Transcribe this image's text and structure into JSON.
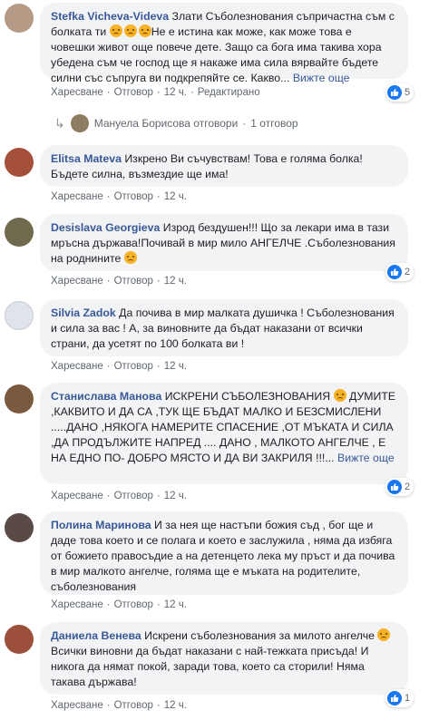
{
  "labels": {
    "like": "Харесване",
    "reply": "Отговор",
    "time": "12 ч.",
    "edited": "Редактирано",
    "see_more": "Вижте още"
  },
  "comments": [
    {
      "author": "Stefka Vicheva-Videva",
      "text": " Злати Съболезнования съпричастна съм с болката ти ",
      "text2": "Не е истина как може, как може това е човешки живот още повече дете. Защо са бога има такива хора убедена съм че господ ще я накаже има сила вярвайте бъдете силни със съпруга ви подкрепяйте се. Какво...",
      "likes": "5",
      "avatar_color": "#b59a86"
    },
    {
      "author": "Elitsa Mateva",
      "text": " Изкрено Ви съчувствам! Това е голяма болка! Бъдете силна, възмездие ще има!",
      "avatar_color": "#a5503a"
    },
    {
      "author": "Desislava Georgieva",
      "text": " Изрод бездушен!!! Що за лекари има в тази мръсна държава!Почивай в мир мило АНГЕЛЧЕ .Съболезнования на роднините ",
      "likes": "2",
      "avatar_color": "#6f6a4e"
    },
    {
      "author": "Silvia Zadok",
      "text": " Да почива в мир малката душичка ! Съболезнования и сила за вас ! А, за виновните да бъдат наказани от всички страни, да усетят по 100 болката ви !",
      "avatar_color": "#dfe3ea"
    },
    {
      "author": "Станислава Манова",
      "text": " ИСКРЕНИ СЪБОЛЕЗНОВАНИЯ ",
      "text2": " ДУМИТЕ ,КАКВИТО И ДА СА ,ТУК ЩЕ БЪДАТ МАЛКО И БЕЗСМИСЛЕНИ .....ДАНО ,НЯКОГА НАМЕРИТЕ СПАСЕНИЕ ,ОТ МЪКАТА И СИЛА ,ДА ПРОДЪЛЖИТЕ НАПРЕД .... ДАНО , МАЛКОТО АНГЕЛЧЕ , Е НА ЕДНО ПО- ДОБРО МЯСТО И ДА ВИ ЗАКРИЛЯ !!!...",
      "likes": "2",
      "avatar_color": "#7a5a3f"
    },
    {
      "author": "Полина Маринова",
      "text": " И за нея ще настъпи божия съд , бог ще и даде това което и се полага и което е заслужила , няма да избяга от божието правосъдие а на детенцето лека му пръст и да почива в мир малкото ангелче, голяма ще е мъката на родителите, съболезнования",
      "avatar_color": "#5a4a46"
    },
    {
      "author": "Даниела Венева",
      "text": " Искрени съболезнования за милото ангелче ",
      "text2": "Всички виновни да бъдат наказани с най-тежката присъда! И никога да нямат покой, заради това, което са сторили! Няма такава държава!",
      "likes": "1",
      "avatar_color": "#9c4f3b"
    }
  ],
  "reply_line": {
    "name": "Мануела Борисова отговори",
    "dot": "·",
    "count": "1 отговор"
  }
}
